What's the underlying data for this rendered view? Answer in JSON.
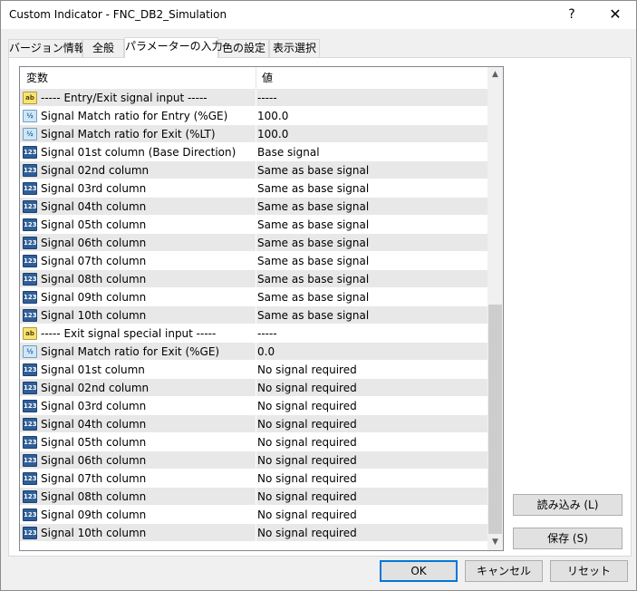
{
  "window": {
    "title": "Custom Indicator - FNC_DB2_Simulation",
    "help_label": "?",
    "close_label": "✕"
  },
  "tabs": [
    {
      "label": "バージョン情報"
    },
    {
      "label": "全般"
    },
    {
      "label": "パラメーターの入力"
    },
    {
      "label": "色の設定"
    },
    {
      "label": "表示選択"
    }
  ],
  "grid": {
    "headers": {
      "variable": "変数",
      "value": "値"
    },
    "rows": [
      {
        "icon": "ab",
        "icon_name": "string-icon",
        "name": "----- Entry/Exit signal input -----",
        "value": "-----"
      },
      {
        "icon": "½",
        "icon_name": "double-icon",
        "name": "Signal Match ratio for Entry (%GE)",
        "value": "100.0"
      },
      {
        "icon": "½",
        "icon_name": "double-icon",
        "name": "Signal Match ratio for Exit (%LT)",
        "value": "100.0"
      },
      {
        "icon": "123",
        "icon_name": "enum-icon",
        "name": "Signal 01st column (Base Direction)",
        "value": "Base signal"
      },
      {
        "icon": "123",
        "icon_name": "enum-icon",
        "name": "Signal 02nd column",
        "value": "Same as base signal"
      },
      {
        "icon": "123",
        "icon_name": "enum-icon",
        "name": "Signal 03rd column",
        "value": "Same as base signal"
      },
      {
        "icon": "123",
        "icon_name": "enum-icon",
        "name": "Signal 04th column",
        "value": "Same as base signal"
      },
      {
        "icon": "123",
        "icon_name": "enum-icon",
        "name": "Signal 05th column",
        "value": "Same as base signal"
      },
      {
        "icon": "123",
        "icon_name": "enum-icon",
        "name": "Signal 06th column",
        "value": "Same as base signal"
      },
      {
        "icon": "123",
        "icon_name": "enum-icon",
        "name": "Signal 07th column",
        "value": "Same as base signal"
      },
      {
        "icon": "123",
        "icon_name": "enum-icon",
        "name": "Signal 08th column",
        "value": "Same as base signal"
      },
      {
        "icon": "123",
        "icon_name": "enum-icon",
        "name": "Signal 09th column",
        "value": "Same as base signal"
      },
      {
        "icon": "123",
        "icon_name": "enum-icon",
        "name": "Signal 10th column",
        "value": "Same as base signal"
      },
      {
        "icon": "ab",
        "icon_name": "string-icon",
        "name": "----- Exit signal special input -----",
        "value": "-----"
      },
      {
        "icon": "½",
        "icon_name": "double-icon",
        "name": "Signal Match ratio for Exit (%GE)",
        "value": "0.0"
      },
      {
        "icon": "123",
        "icon_name": "enum-icon",
        "name": "Signal 01st column",
        "value": "No signal required"
      },
      {
        "icon": "123",
        "icon_name": "enum-icon",
        "name": "Signal 02nd column",
        "value": "No signal required"
      },
      {
        "icon": "123",
        "icon_name": "enum-icon",
        "name": "Signal 03rd column",
        "value": "No signal required"
      },
      {
        "icon": "123",
        "icon_name": "enum-icon",
        "name": "Signal 04th column",
        "value": "No signal required"
      },
      {
        "icon": "123",
        "icon_name": "enum-icon",
        "name": "Signal 05th column",
        "value": "No signal required"
      },
      {
        "icon": "123",
        "icon_name": "enum-icon",
        "name": "Signal 06th column",
        "value": "No signal required"
      },
      {
        "icon": "123",
        "icon_name": "enum-icon",
        "name": "Signal 07th column",
        "value": "No signal required"
      },
      {
        "icon": "123",
        "icon_name": "enum-icon",
        "name": "Signal 08th column",
        "value": "No signal required"
      },
      {
        "icon": "123",
        "icon_name": "enum-icon",
        "name": "Signal 09th column",
        "value": "No signal required"
      },
      {
        "icon": "123",
        "icon_name": "enum-icon",
        "name": "Signal 10th column",
        "value": "No signal required"
      }
    ]
  },
  "side_buttons": {
    "load_label": "読み込み (L)",
    "save_label": "保存 (S)"
  },
  "footer_buttons": {
    "ok_label": "OK",
    "cancel_label": "キャンセル",
    "reset_label": "リセット"
  },
  "colors": {
    "row_alt": "#e8e8e8",
    "accent": "#0078d7"
  }
}
